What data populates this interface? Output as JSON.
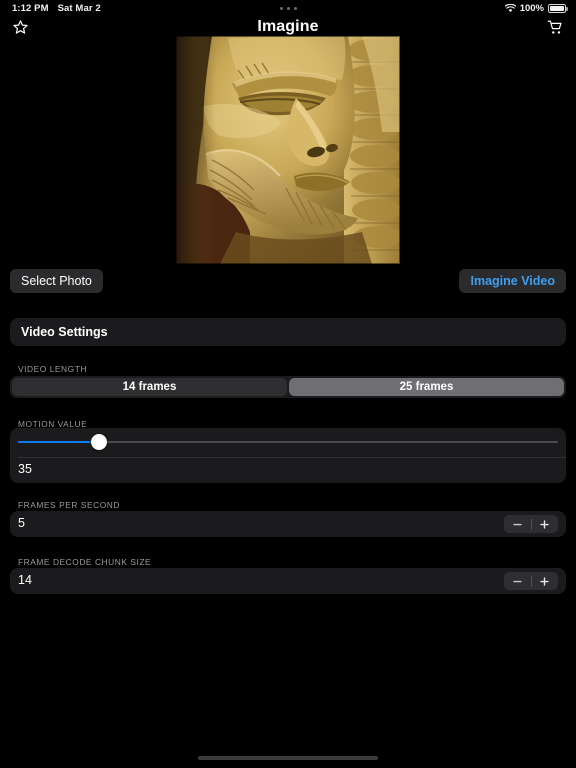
{
  "status_bar": {
    "time": "1:12 PM",
    "date": "Sat Mar 2",
    "battery_percent": "100%",
    "wifi_icon": "wifi-icon",
    "battery_icon": "battery-icon",
    "multitask_handle": "multitask-dots"
  },
  "nav": {
    "title": "Imagine",
    "left_icon": "star-outline-icon",
    "right_icon": "shopping-cart-icon"
  },
  "hero": {
    "alt": "sand sculpture face photo",
    "name": "selected-photo-preview"
  },
  "actions": {
    "select_photo_label": "Select Photo",
    "imagine_video_label": "Imagine Video",
    "accent_color": "#3c9ff0"
  },
  "settings": {
    "card_title": "Video Settings",
    "video_length": {
      "label": "VIDEO LENGTH",
      "options": [
        "14 frames",
        "25 frames"
      ],
      "selected_index": 1
    },
    "motion_value": {
      "label": "MOTION VALUE",
      "value": "35",
      "percent": 15,
      "fill_color": "#0a7cf0"
    },
    "frames_per_second": {
      "label": "FRAMES PER SECOND",
      "value": "5",
      "decrement": "−",
      "increment": "+"
    },
    "frame_decode_chunk_size": {
      "label": "FRAME DECODE CHUNK SIZE",
      "value": "14",
      "decrement": "−",
      "increment": "+"
    }
  },
  "home_indicator": "home-indicator"
}
